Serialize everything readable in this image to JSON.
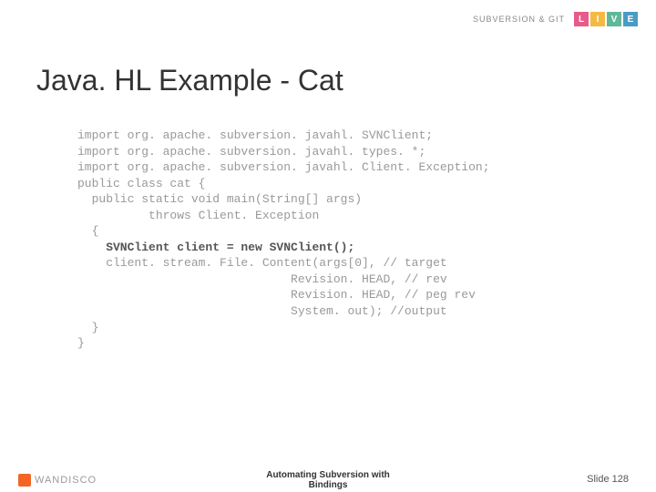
{
  "header": {
    "brand_text": "SUBVERSION & GIT",
    "live": [
      "L",
      "I",
      "V",
      "E"
    ]
  },
  "slide": {
    "title": "Java. HL Example - Cat",
    "code": {
      "l1": "import org. apache. subversion. javahl. SVNClient;",
      "l2": "import org. apache. subversion. javahl. types. *;",
      "l3": "import org. apache. subversion. javahl. Client. Exception;",
      "l4": "",
      "l5": "public class cat {",
      "l6": "  public static void main(String[] args)",
      "l7": "          throws Client. Exception",
      "l8": "  {",
      "l9_bold": "    SVNClient client = new SVNClient();",
      "l10": "    client. stream. File. Content(args[0], // target",
      "l11": "                              Revision. HEAD, // rev",
      "l12": "                              Revision. HEAD, // peg rev",
      "l13": "                              System. out); //output",
      "l14": "  }",
      "l15": "}"
    }
  },
  "footer": {
    "logo_text": "WANDISCO",
    "center_l1": "Automating Subversion with",
    "center_l2": "Bindings",
    "right": "Slide 128"
  }
}
